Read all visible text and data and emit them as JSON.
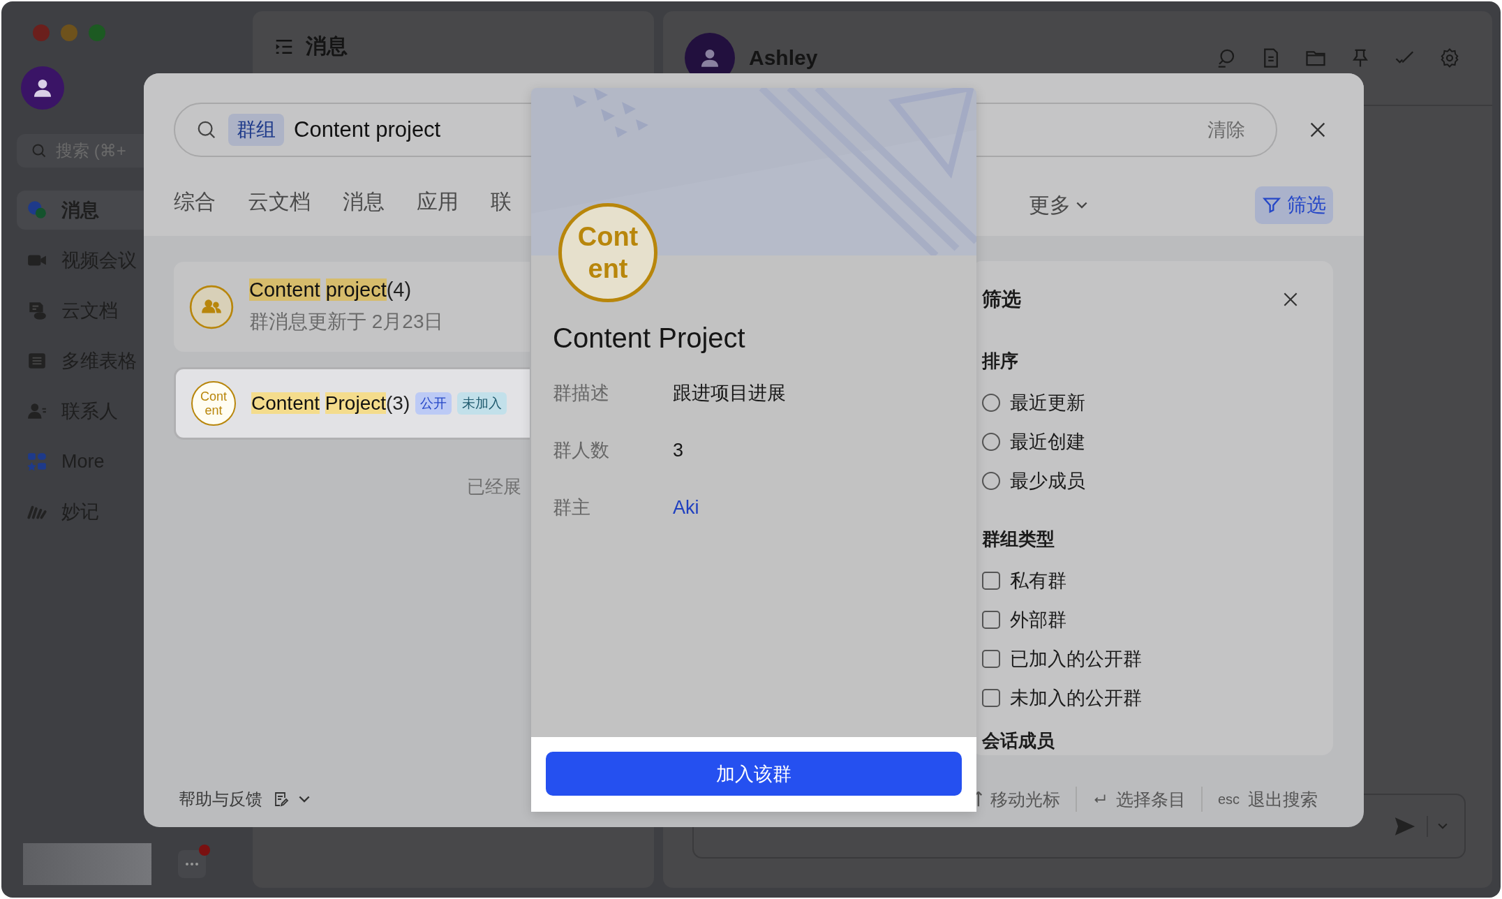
{
  "sidebar": {
    "search": {
      "placeholder": "搜索 (⌘+"
    },
    "items": [
      {
        "label": "消息",
        "kind": "chat",
        "selected": true
      },
      {
        "label": "视频会议",
        "kind": "video",
        "selected": false
      },
      {
        "label": "云文档",
        "kind": "docs",
        "selected": false
      },
      {
        "label": "多维表格",
        "kind": "table",
        "selected": false
      },
      {
        "label": "联系人",
        "kind": "contacts",
        "selected": false
      },
      {
        "label": "More",
        "kind": "more",
        "selected": false
      },
      {
        "label": "妙记",
        "kind": "notes",
        "selected": false
      }
    ]
  },
  "message_panel": {
    "title": "消息"
  },
  "chat": {
    "name": "Ashley"
  },
  "search_modal": {
    "search": {
      "scope_tag": "群组",
      "value": "Content project",
      "clear": "清除"
    },
    "tabs": [
      {
        "label": "综合",
        "selected": false
      },
      {
        "label": "云文档",
        "selected": false
      },
      {
        "label": "消息",
        "selected": false
      },
      {
        "label": "应用",
        "selected": false
      },
      {
        "label": "联",
        "selected": false
      }
    ],
    "more_tab": "更多",
    "filter_button": "筛选",
    "results": [
      {
        "title_words": [
          "Content",
          "project"
        ],
        "count": "(4)",
        "subtitle": "群消息更新于 2月23日",
        "selected": false
      },
      {
        "avatar_text": "Content",
        "title_words": [
          "Content",
          "Project"
        ],
        "count": "(3)",
        "selected": true,
        "tags": [
          {
            "label": "公开",
            "kind": "public"
          },
          {
            "label": "未加入",
            "kind": "status"
          }
        ]
      }
    ],
    "results_end": "已经展",
    "filter": {
      "title": "筛选",
      "sections": [
        {
          "title": "排序",
          "kind": "radio",
          "options": [
            {
              "label": "最近更新",
              "selected": false
            },
            {
              "label": "最近创建",
              "selected": false
            },
            {
              "label": "最少成员",
              "selected": false
            }
          ]
        },
        {
          "title": "群组类型",
          "kind": "checkbox",
          "options": [
            {
              "label": "私有群",
              "checked": false
            },
            {
              "label": "外部群",
              "checked": false
            },
            {
              "label": "已加入的公开群",
              "checked": false
            },
            {
              "label": "未加入的公开群",
              "checked": false
            }
          ]
        },
        {
          "title": "会话成员",
          "kind": "heading"
        }
      ]
    },
    "footer": {
      "help": "帮助与反馈",
      "hints": [
        {
          "kind": "move",
          "label": "移动光标"
        },
        {
          "kind": "enter",
          "label": "选择条目"
        },
        {
          "kind": "esc",
          "key": "esc",
          "label": "退出搜索"
        }
      ]
    }
  },
  "group_card": {
    "avatar_text": "Content",
    "name": "Content Project",
    "fields": [
      {
        "label": "群描述",
        "value": "跟进项目进展",
        "kind": "text"
      },
      {
        "label": "群人数",
        "value": "3",
        "kind": "text"
      },
      {
        "label": "群主",
        "value": "Aki",
        "kind": "link"
      }
    ],
    "join_button": "加入该群"
  }
}
